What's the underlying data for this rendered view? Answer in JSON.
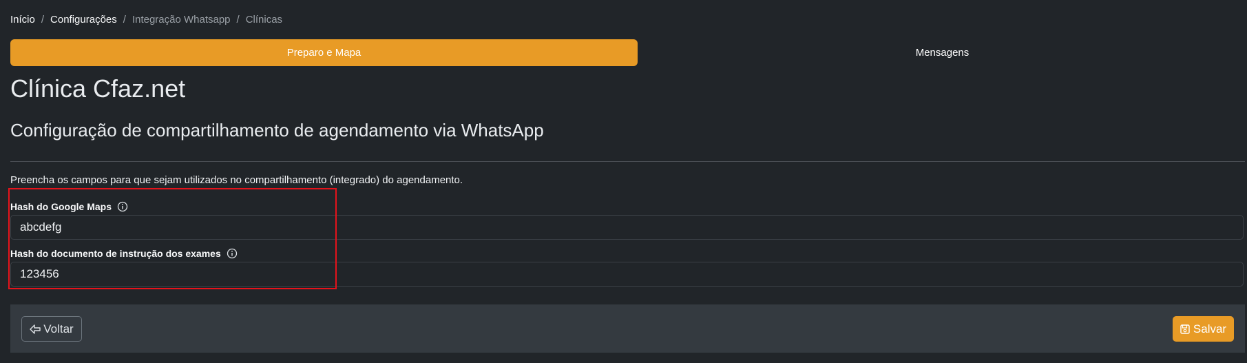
{
  "breadcrumb": {
    "items": [
      "Início",
      "Configurações",
      "Integração Whatsapp",
      "Clínicas"
    ],
    "separator": "/"
  },
  "tabs": [
    {
      "label": "Preparo e Mapa",
      "active": true
    },
    {
      "label": "Mensagens",
      "active": false
    }
  ],
  "clinic_name": "Clínica Cfaz.net",
  "section_title": "Configuração de compartilhamento de agendamento via WhatsApp",
  "instructions": "Preencha os campos para que sejam utilizados no compartilhamento (integrado) do agendamento.",
  "fields": {
    "maps": {
      "label": "Hash do Google Maps",
      "value": "abcdefg",
      "icon": "info-icon"
    },
    "doc": {
      "label": "Hash do documento de instrução dos exames",
      "value": "123456",
      "icon": "info-icon"
    }
  },
  "footer": {
    "back_label": "Voltar",
    "back_icon": "arrow-left-icon",
    "save_label": "Salvar",
    "save_icon": "floppy-disk-icon"
  },
  "colors": {
    "background": "#212529",
    "accent": "#e89b26",
    "footer_bg": "#343a40",
    "highlight": "#e5131b"
  }
}
